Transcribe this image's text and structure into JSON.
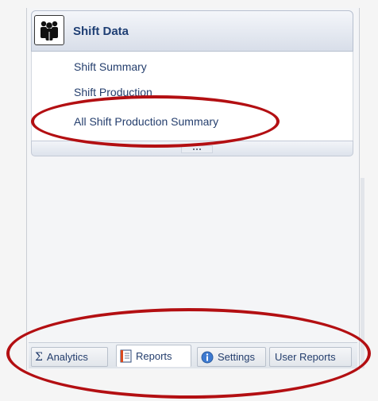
{
  "shift_data": {
    "title": "Shift Data",
    "icon": "people-group-icon",
    "items": [
      {
        "label": "Shift Summary"
      },
      {
        "label": "Shift Production"
      },
      {
        "label": "All Shift Production Summary"
      }
    ]
  },
  "tabs": [
    {
      "label": "Analytics",
      "icon": "sigma-icon",
      "active": false
    },
    {
      "label": "Reports",
      "icon": "report-document-icon",
      "active": true
    },
    {
      "label": "Settings",
      "icon": "info-icon",
      "active": false
    },
    {
      "label": "User Reports",
      "icon": "",
      "active": false
    }
  ],
  "colors": {
    "annotation": "#b30f12",
    "link_text": "#243e6d",
    "header_title": "#1f3f74"
  }
}
